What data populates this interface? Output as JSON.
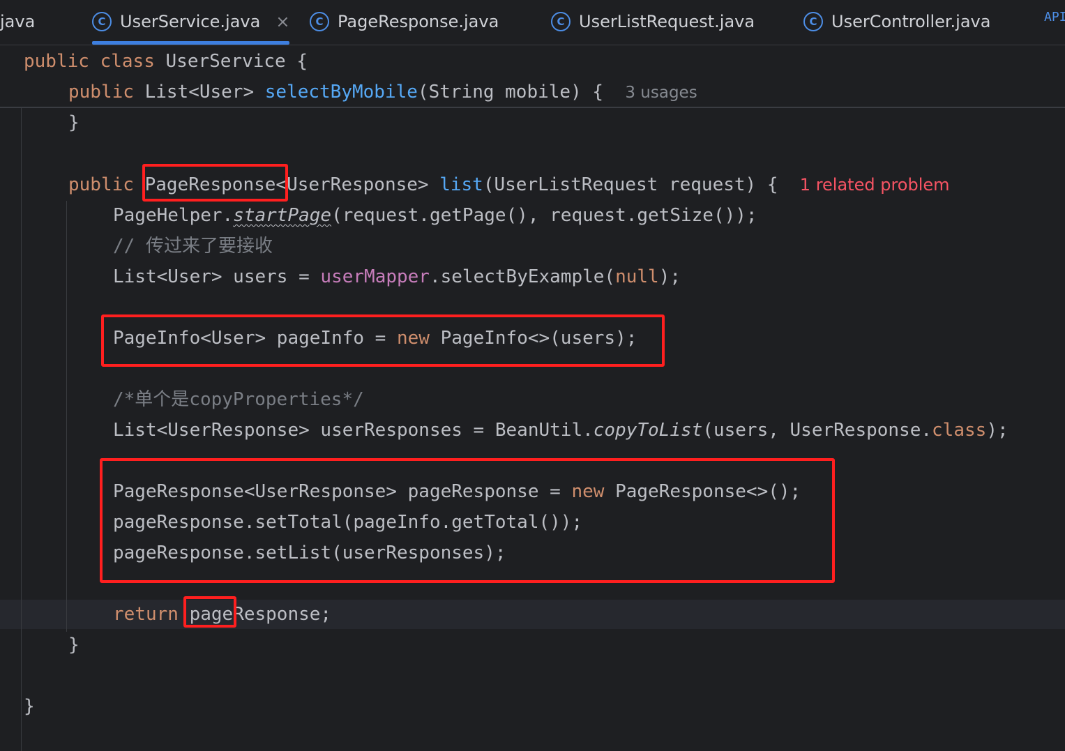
{
  "tabs": [
    {
      "label": "java",
      "icon": "class-icon",
      "active": false,
      "partial": true
    },
    {
      "label": "UserService.java",
      "icon": "class-icon",
      "active": true,
      "close": "×"
    },
    {
      "label": "PageResponse.java",
      "icon": "class-icon",
      "active": false
    },
    {
      "label": "UserListRequest.java",
      "icon": "class-icon",
      "active": false
    },
    {
      "label": "UserController.java",
      "icon": "class-icon",
      "active": false
    },
    {
      "label": "API",
      "icon": "",
      "active": false,
      "partial": true
    }
  ],
  "tab_icon_glyph": "C",
  "code": {
    "class_decl": {
      "kw1": "public",
      "kw2": "class",
      "name": " UserService {"
    },
    "method1": {
      "kw": "public",
      "type": " List<User> ",
      "fn": "selectByMobile",
      "rest": "(String mobile) {",
      "hint": "3 usages"
    },
    "close1": "}",
    "method2": {
      "kw": "public",
      "type": " PageResponse<UserResponse> ",
      "fn": "list",
      "rest": "(UserListRequest request) {",
      "problem": "1 related problem"
    },
    "l_pagehelper": {
      "a": "PageHelper.",
      "b": "startPage",
      "c": "(request.getPage(), request.getSize());"
    },
    "l_comment1": "// 传过来了要接收",
    "l_users": {
      "a": "List<User> users = ",
      "b": "userMapper",
      "c": ".selectByExample(",
      "d": "null",
      "e": ");"
    },
    "l_pageinfo": {
      "a": "PageInfo<User> pageInfo = ",
      "b": "new",
      "c": " PageInfo<>(users);"
    },
    "l_comment2": "/*单个是copyProperties*/",
    "l_copy": {
      "a": "List<UserResponse> userResponses = BeanUtil.",
      "b": "copyToList",
      "c": "(users, UserResponse.",
      "d": "class",
      "e": ");"
    },
    "l_resp1": {
      "a": "PageResponse<UserResponse> pageResponse = ",
      "b": "new",
      "c": " PageResponse<>();"
    },
    "l_resp2": "pageResponse.setTotal(pageInfo.getTotal());",
    "l_resp3": "pageResponse.setList(userResponses);",
    "l_return": {
      "a": "return",
      "b": " pageResponse;"
    },
    "close2": "}",
    "close3": "}"
  },
  "colors": {
    "background": "#1e1f22",
    "keyword": "#cf8e6d",
    "function": "#56a8f5",
    "field": "#c77dbb",
    "comment": "#7a7e85",
    "text": "#bcbec4",
    "problem": "#f75464",
    "annotation_box": "#ff1f1f",
    "tab_accent": "#3d7fe0"
  }
}
